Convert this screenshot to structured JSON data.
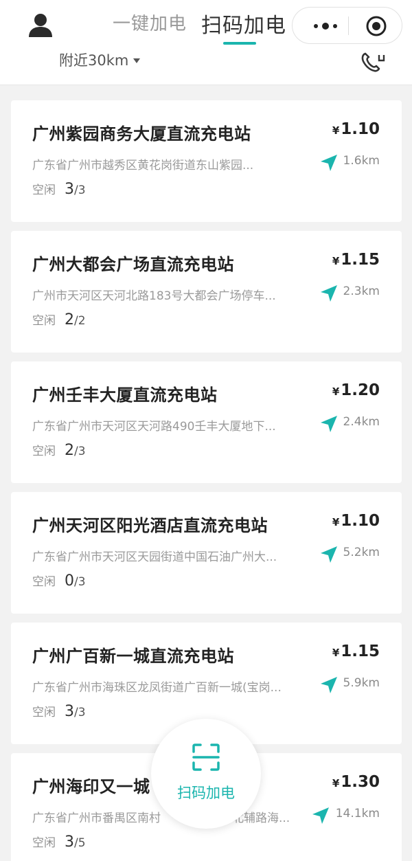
{
  "header": {
    "tabs": [
      {
        "label": "一键加电",
        "active": false
      },
      {
        "label": "扫码加电",
        "active": true
      }
    ],
    "distance_filter": "附近30km",
    "accent_color": "#1bb5ae"
  },
  "icons": {
    "avatar": "user-icon",
    "more": "more-dots-icon",
    "target": "target-icon",
    "phone": "customer-service-phone-icon",
    "navigate": "navigate-arrow-icon",
    "scan": "scan-frame-icon"
  },
  "stations": [
    {
      "name": "广州紫园商务大厦直流充电站",
      "address": "广东省广州市越秀区黄花岗街道东山紫园...",
      "idle_label": "空闲",
      "idle_free": "3",
      "idle_total": "/3",
      "currency": "¥",
      "price": "1.10",
      "distance": "1.6km"
    },
    {
      "name": "广州大都会广场直流充电站",
      "address": "广州市天河区天河北路183号大都会广场停车...",
      "idle_label": "空闲",
      "idle_free": "2",
      "idle_total": "/2",
      "currency": "¥",
      "price": "1.15",
      "distance": "2.3km"
    },
    {
      "name": "广州壬丰大厦直流充电站",
      "address": "广东省广州市天河区天河路490壬丰大厦地下...",
      "idle_label": "空闲",
      "idle_free": "2",
      "idle_total": "/3",
      "currency": "¥",
      "price": "1.20",
      "distance": "2.4km"
    },
    {
      "name": "广州天河区阳光酒店直流充电站",
      "address": "广东省广州市天河区天园街道中国石油广州大...",
      "idle_label": "空闲",
      "idle_free": "0",
      "idle_total": "/3",
      "currency": "¥",
      "price": "1.10",
      "distance": "5.2km"
    },
    {
      "name": "广州广百新一城直流充电站",
      "address": "广东省广州市海珠区龙凤街道广百新一城(宝岗...",
      "idle_label": "空闲",
      "idle_free": "3",
      "idle_total": "/3",
      "currency": "¥",
      "price": "1.15",
      "distance": "5.9km"
    },
    {
      "name": "广州海印又一城",
      "address": "广东省广州市番禺区南村",
      "address_tail": "北辅路海...",
      "idle_label": "空闲",
      "idle_free": "3",
      "idle_total": "/5",
      "currency": "¥",
      "price": "1.30",
      "distance": "14.1km"
    }
  ],
  "scan_button": {
    "label": "扫码加电"
  }
}
